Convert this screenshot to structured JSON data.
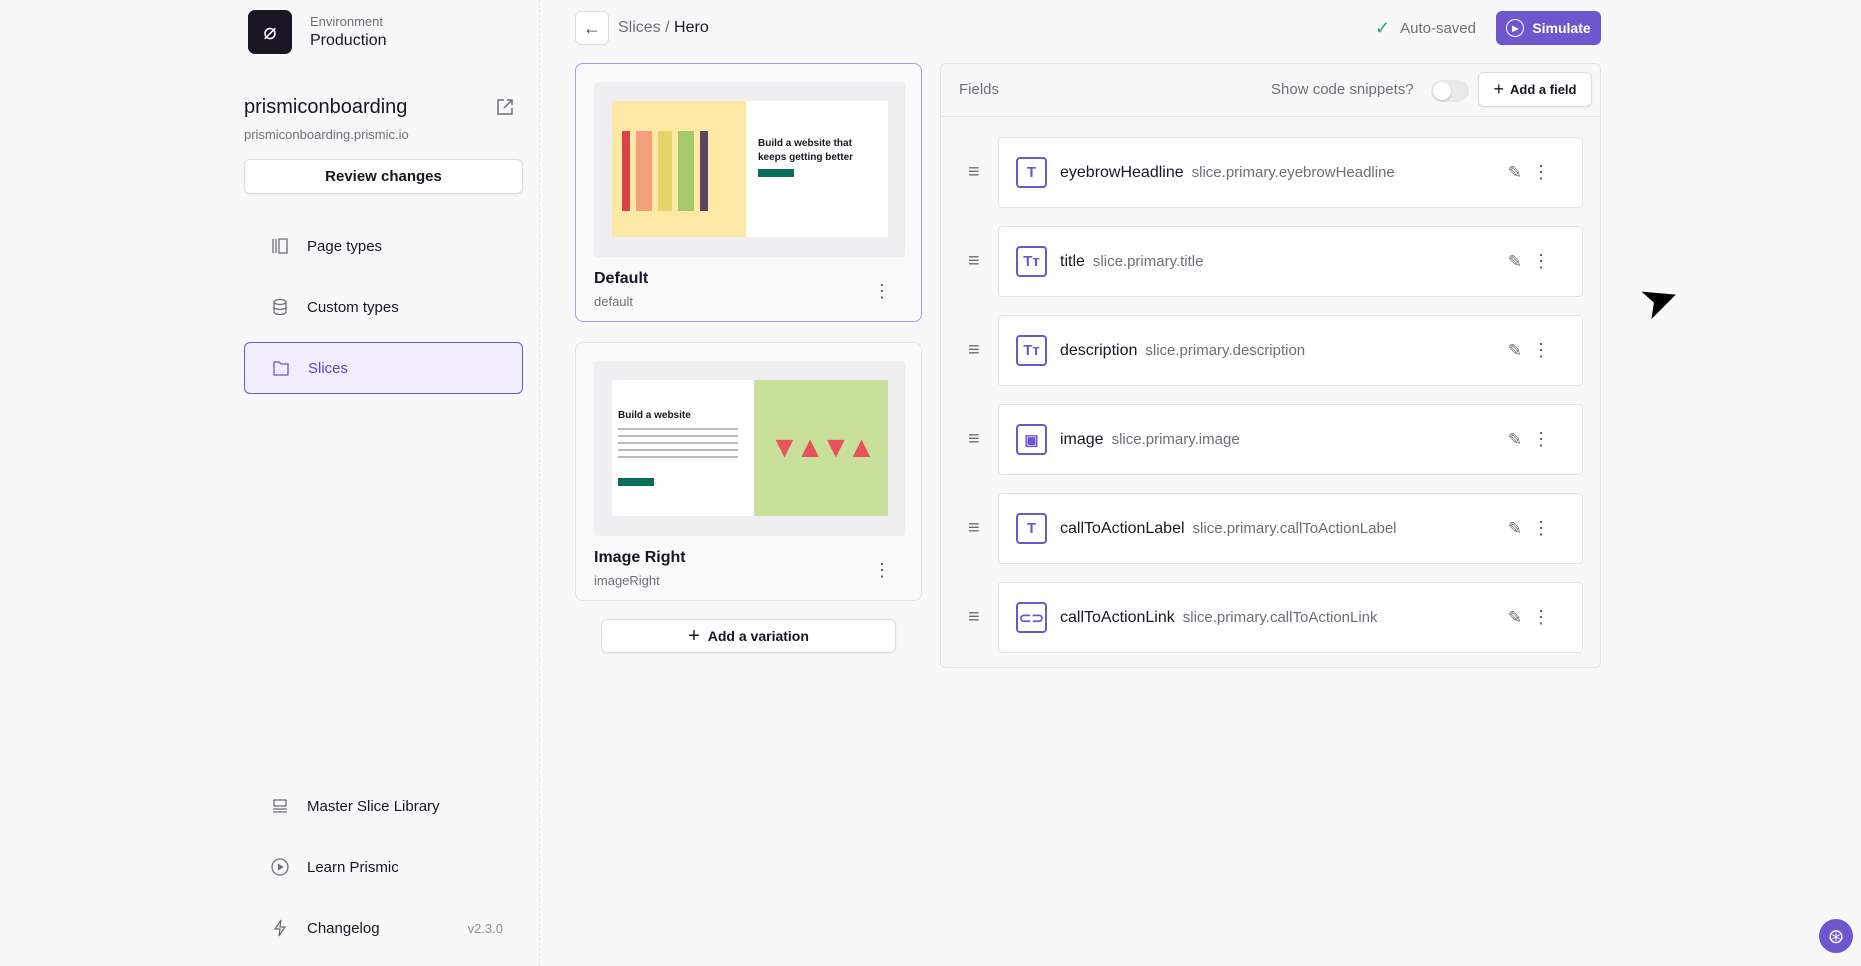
{
  "sidebar": {
    "environment_label": "Environment",
    "environment_name": "Production",
    "repo_name": "prismiconboarding",
    "repo_url": "prismiconboarding.prismic.io",
    "review_button": "Review changes",
    "nav": [
      {
        "label": "Page types",
        "icon": "page-types-icon"
      },
      {
        "label": "Custom types",
        "icon": "database-icon"
      },
      {
        "label": "Slices",
        "icon": "folder-icon",
        "active": true
      }
    ],
    "bottom": [
      {
        "label": "Master Slice Library",
        "icon": "library-icon"
      },
      {
        "label": "Learn Prismic",
        "icon": "play-circle-icon"
      },
      {
        "label": "Changelog",
        "icon": "lightning-icon",
        "version": "v2.3.0"
      }
    ]
  },
  "header": {
    "breadcrumb_parent": "Slices",
    "breadcrumb_sep": " / ",
    "breadcrumb_current": "Hero",
    "autosaved": "Auto-saved",
    "simulate": "Simulate"
  },
  "variations": [
    {
      "title": "Default",
      "id": "default",
      "preview_heading": "Build a website that keeps getting better"
    },
    {
      "title": "Image Right",
      "id": "imageRight",
      "preview_heading": "Build a website"
    }
  ],
  "add_variation": "Add a variation",
  "fields_panel": {
    "title": "Fields",
    "snippets_label": "Show code snippets?",
    "snippets_on": false,
    "add_field": "Add a field",
    "fields": [
      {
        "name": "eyebrowHeadline",
        "path": "slice.primary.eyebrowHeadline",
        "icon": "T"
      },
      {
        "name": "title",
        "path": "slice.primary.title",
        "icon": "Tт"
      },
      {
        "name": "description",
        "path": "slice.primary.description",
        "icon": "Tт"
      },
      {
        "name": "image",
        "path": "slice.primary.image",
        "icon": "▣"
      },
      {
        "name": "callToActionLabel",
        "path": "slice.primary.callToActionLabel",
        "icon": "T"
      },
      {
        "name": "callToActionLink",
        "path": "slice.primary.callToActionLink",
        "icon": "⊂⊃"
      }
    ]
  },
  "colors": {
    "accent": "#6e56cf",
    "success": "#30a46c"
  }
}
